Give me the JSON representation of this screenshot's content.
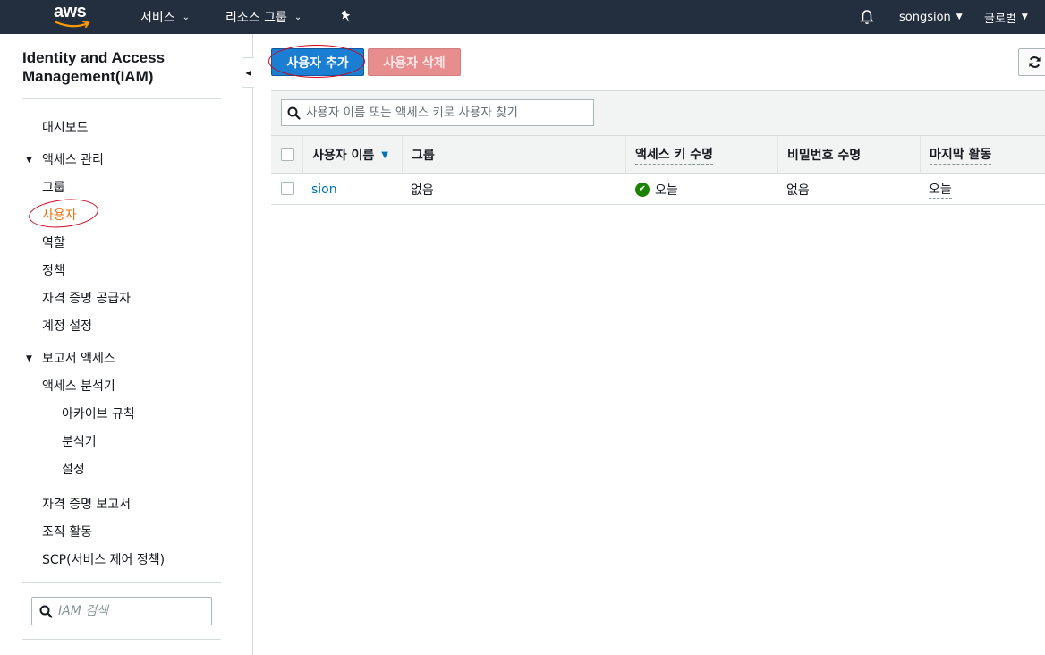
{
  "topnav": {
    "logo_text": "aws",
    "services_label": "서비스",
    "resource_groups_label": "리소스 그룹",
    "pin_icon": "pin-icon",
    "bell_icon": "bell-icon",
    "user_label": "songsion",
    "region_label": "글로벌"
  },
  "sidebar": {
    "title_line1": "Identity and Access",
    "title_line2": "Management(IAM)",
    "dashboard": "대시보드",
    "access_management": "액세스 관리",
    "groups": "그룹",
    "users": "사용자",
    "roles": "역할",
    "policies": "정책",
    "identity_providers": "자격 증명 공급자",
    "account_settings": "계정 설정",
    "access_reports": "보고서 액세스",
    "access_analyzer": "액세스 분석기",
    "archive_rules": "아카이브 규칙",
    "analyzers": "분석기",
    "settings": "설정",
    "credential_report": "자격 증명 보고서",
    "organization_activity": "조직 활동",
    "scp": "SCP(서비스 제어 정책)",
    "search_placeholder": "IAM 검색"
  },
  "toolbar": {
    "add_user": "사용자 추가",
    "delete_user": "사용자 삭제",
    "refresh_icon": "refresh-icon"
  },
  "table": {
    "filter_placeholder": "사용자 이름 또는 액세스 키로 사용자 찾기",
    "columns": [
      "사용자 이름",
      "그룹",
      "액세스 키 수명",
      "비밀번호 수명",
      "마지막 활동"
    ],
    "rows": [
      {
        "username": "sion",
        "groups": "없음",
        "access_key_age": "오늘",
        "password_age": "없음",
        "last_activity": "오늘"
      }
    ]
  },
  "colors": {
    "nav_bg": "#232f3e",
    "primary_button": "#1a7ed3",
    "danger_button_disabled": "#e88d8d",
    "active_nav": "#ec7211",
    "link": "#0073bb",
    "ok_green": "#1d8102",
    "annotation_red": "#d0021b"
  }
}
